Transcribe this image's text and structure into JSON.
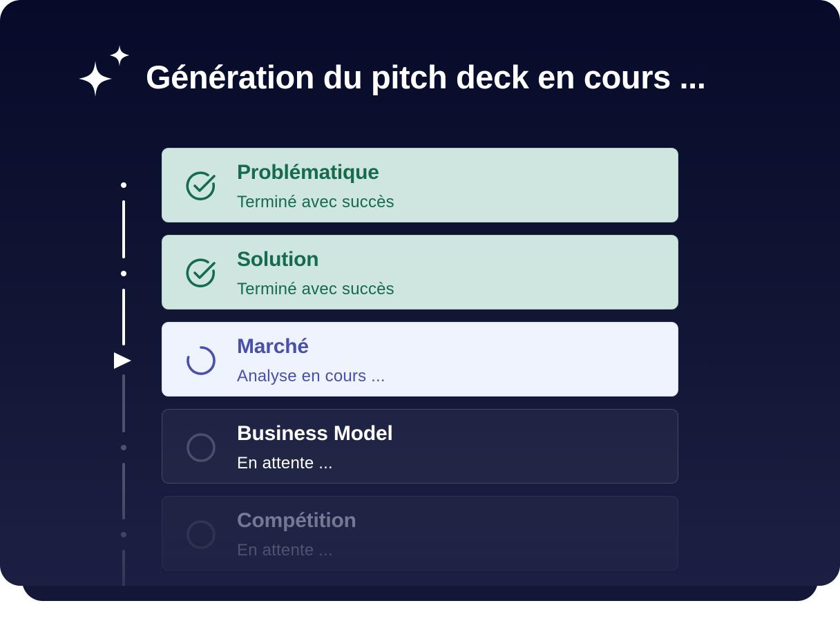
{
  "header": {
    "title": "Génération du pitch deck en cours ...",
    "icon": "sparkles-icon"
  },
  "steps": [
    {
      "label": "Problématique",
      "status_text": "Terminé avec succès",
      "state": "done",
      "icon": "check-circle-icon"
    },
    {
      "label": "Solution",
      "status_text": "Terminé avec succès",
      "state": "done",
      "icon": "check-circle-icon"
    },
    {
      "label": "Marché",
      "status_text": "Analyse en cours ...",
      "state": "in-progress",
      "icon": "spinner-icon"
    },
    {
      "label": "Business Model",
      "status_text": "En attente ...",
      "state": "pending",
      "icon": "empty-circle-icon"
    },
    {
      "label": "Compétition",
      "status_text": "En attente ...",
      "state": "pending",
      "icon": "empty-circle-icon"
    }
  ],
  "colors": {
    "background": "#0b0f30",
    "done_bg": "#cfe5df",
    "done_text": "#146b4d",
    "active_bg": "#eef3fd",
    "active_text": "#4a50a8"
  }
}
